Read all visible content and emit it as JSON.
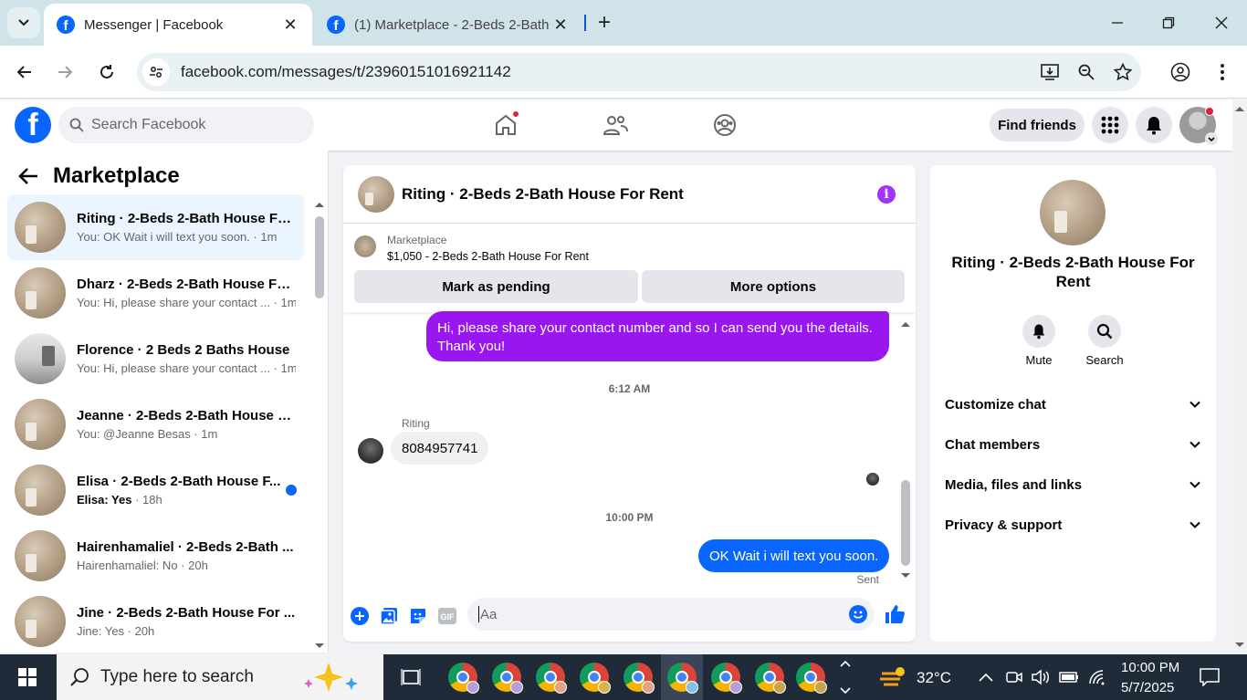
{
  "browser": {
    "tabs": [
      {
        "title": "Messenger | Facebook",
        "close": "✕"
      },
      {
        "title": "(1) Marketplace - 2-Beds 2-Bath",
        "close": "✕"
      }
    ],
    "new_tab": "+",
    "url": "facebook.com/messages/t/23960151016921142"
  },
  "fb_header": {
    "logo": "f",
    "search_placeholder": "Search Facebook",
    "find_friends": "Find friends"
  },
  "sidebar": {
    "title": "Marketplace",
    "conversations": [
      {
        "name": "Riting · 2-Beds 2-Bath House Fo...",
        "preview": "You: OK Wait i will text you soon. · 1m",
        "selected": true
      },
      {
        "name": "Dharz · 2-Beds 2-Bath House Fo...",
        "preview": "You: Hi, please share your contact ... · 1m"
      },
      {
        "name": "Florence · 2 Beds 2 Baths House",
        "preview": "You: Hi, please share your contact ... · 1m"
      },
      {
        "name": "Jeanne · 2-Beds 2-Bath House F...",
        "preview": "You: @Jeanne Besas · 1m"
      },
      {
        "name": "Elisa · 2-Beds 2-Bath House F...",
        "preview_sender": "Elisa: Yes",
        "preview_time": " · 18h",
        "unread": true
      },
      {
        "name": "Hairenhamaliel · 2-Beds 2-Bath ...",
        "preview": "Hairenhamaliel: No · 20h"
      },
      {
        "name": "Jine · 2-Beds 2-Bath House For ...",
        "preview": "Jine: Yes · 20h"
      }
    ]
  },
  "chat": {
    "title": "Riting · 2-Beds 2-Bath House For Rent",
    "banner": {
      "label": "Marketplace",
      "listing": "$1,050 - 2-Beds 2-Bath House For Rent",
      "mark_pending": "Mark as pending",
      "more_options": "More options"
    },
    "messages": {
      "outgoing_1": "Hi, please share your contact number and so I can send you the details. Thank you!",
      "time_1": "6:12 AM",
      "sender": "Riting",
      "incoming_1": "8084957741",
      "time_2": "10:00 PM",
      "outgoing_2": "OK Wait i will text you soon.",
      "status": "Sent"
    },
    "composer_placeholder": "Aa",
    "gif_label": "GIF"
  },
  "details": {
    "name": "Riting · 2-Beds 2-Bath House For Rent",
    "actions": [
      {
        "label": "Mute"
      },
      {
        "label": "Search"
      }
    ],
    "sections": [
      "Customize chat",
      "Chat members",
      "Media, files and links",
      "Privacy & support"
    ]
  },
  "taskbar": {
    "search_placeholder": "Type here to search",
    "weather": "32°C",
    "time": "10:00 PM",
    "date": "5/7/2025"
  },
  "colors": {
    "fb_blue": "#0866ff",
    "purple_bubble": "#9a16ef",
    "info_purple": "#a033ff",
    "notification_red": "#e41e3f"
  }
}
